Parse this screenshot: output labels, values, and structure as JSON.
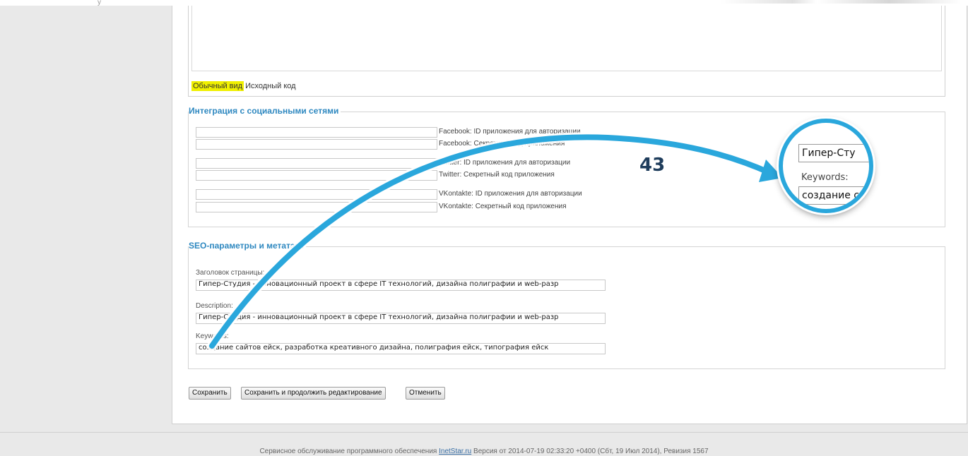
{
  "editor": {
    "tab_visual": "Обычный вид",
    "tab_source": "Исходный код"
  },
  "social": {
    "legend": "Интеграция с социальными сетями",
    "fields": [
      {
        "label": "Facebook: ID приложения для авторизации",
        "value": ""
      },
      {
        "label": "Facebook: Секретный код приложения",
        "value": ""
      },
      {
        "label": "Twitter: ID приложения для авторизации",
        "value": ""
      },
      {
        "label": "Twitter: Секретный код приложения",
        "value": ""
      },
      {
        "label": "VKontakte: ID приложения для авторизации",
        "value": ""
      },
      {
        "label": "VKontakte: Секретный код приложения",
        "value": ""
      }
    ]
  },
  "seo": {
    "legend": "SEO-параметры и метатэги",
    "title_label": "Заголовок страницы:",
    "title_value": "Гипер-Студия - инновационный проект в сфере IT технологий, дизайна полиграфии и web-разр",
    "description_label": "Description:",
    "description_value": "Гипер-Студия - инновационный проект в сфере IT технологий, дизайна полиграфии и web-разр",
    "keywords_label": "Keywords:",
    "keywords_value": "создание сайтов ейск, разработка креативного дизайна, полиграфия ейск, типография ейск"
  },
  "buttons": {
    "save": "Сохранить",
    "save_continue": "Сохранить и продолжить редактирование",
    "cancel": "Отменить"
  },
  "footer": {
    "prefix": "Сервисное обслуживание программного обеспечения",
    "link": "InetStar.ru",
    "suffix": "Версия от 2014-07-19 02:33:20 +0400 (Сбт, 19 Июл 2014), Ревизия 1567"
  },
  "annotation": {
    "step_number": "43",
    "arrow_color": "#2aa7dc",
    "zoom": {
      "title_text": "Гипер-Сту",
      "label": "Keywords:",
      "keywords_text": "создание с"
    }
  },
  "top": {
    "mark": "y"
  }
}
